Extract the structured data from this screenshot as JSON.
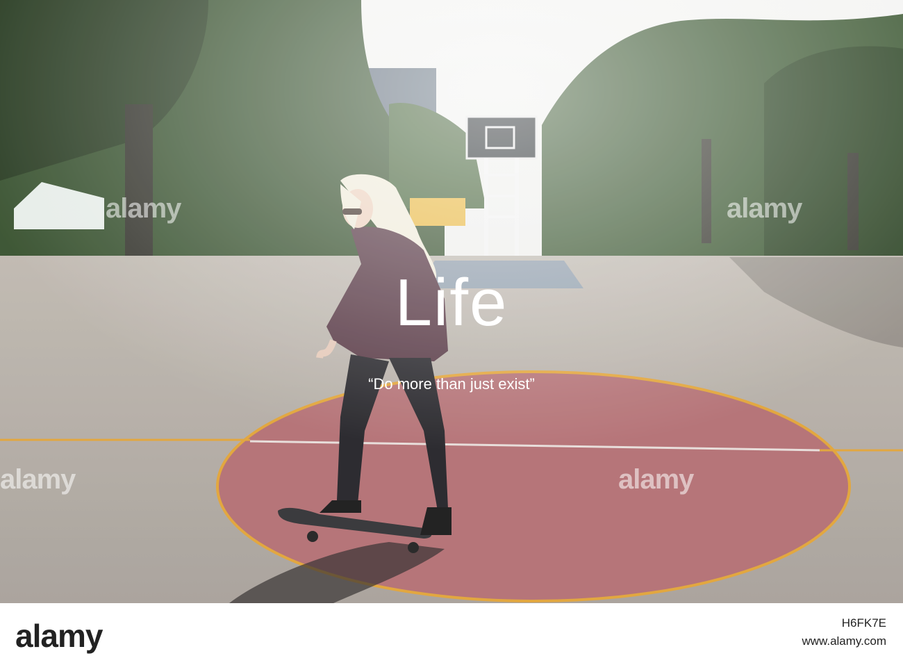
{
  "overlay": {
    "title": "Life",
    "quote": "“Do more than just exist”"
  },
  "watermark": {
    "text": "alamy"
  },
  "footer": {
    "logo": "alamy",
    "image_id": "H6FK7E",
    "site": "www.alamy.com"
  },
  "colors": {
    "court": "#c9c4bb",
    "center_circle": "#b06a6e",
    "court_line": "#e0a030",
    "trees": "#2f4a26",
    "sky": "#eef0ee"
  }
}
